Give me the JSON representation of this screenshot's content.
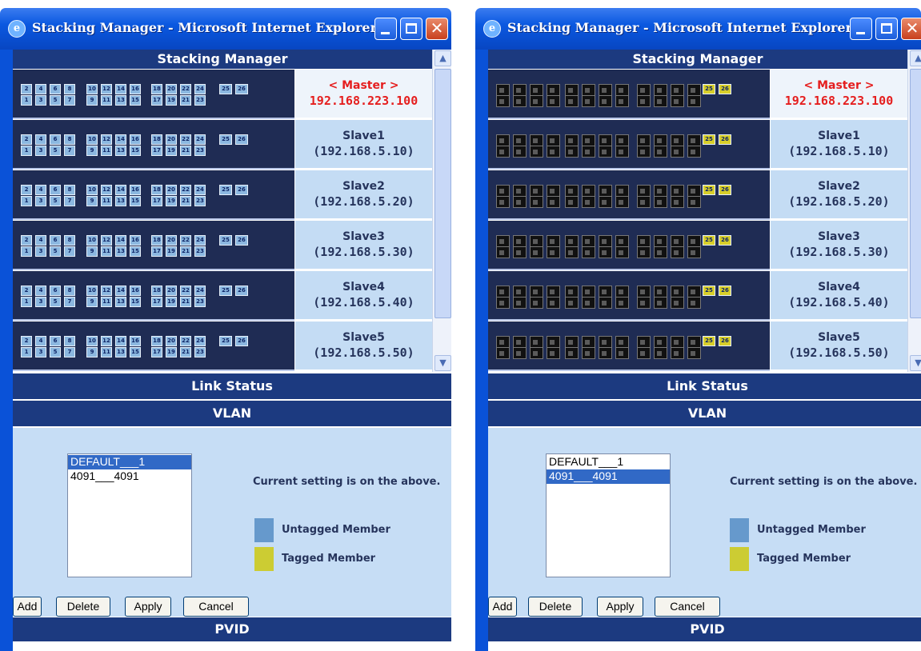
{
  "window": {
    "title": "Stacking Manager - Microsoft Internet Explorer",
    "close_glyph": "✕"
  },
  "page": {
    "header": "Stacking Manager",
    "link_status": "Link Status",
    "vlan_header": "VLAN",
    "pvid_header": "PVID",
    "current_setting": "Current setting is on the above.",
    "legend_untagged": "Untagged Member",
    "legend_tagged": "Tagged Member",
    "colors": {
      "untagged": "#6699cc",
      "tagged": "#cccc33",
      "selection": "#3169c6"
    }
  },
  "units": [
    {
      "name": "< Master >",
      "ip": "192.168.223.100"
    },
    {
      "name": "Slave1",
      "ip": "(192.168.5.10)"
    },
    {
      "name": "Slave2",
      "ip": "(192.168.5.20)"
    },
    {
      "name": "Slave3",
      "ip": "(192.168.5.30)"
    },
    {
      "name": "Slave4",
      "ip": "(192.168.5.40)"
    },
    {
      "name": "Slave5",
      "ip": "(192.168.5.50)"
    }
  ],
  "ports": {
    "top": [
      "2",
      "4",
      "6",
      "8",
      "10",
      "12",
      "14",
      "16",
      "18",
      "20",
      "22",
      "24"
    ],
    "bottom": [
      "1",
      "3",
      "5",
      "7",
      "9",
      "11",
      "13",
      "15",
      "17",
      "19",
      "21",
      "23"
    ],
    "uplink": [
      "25",
      "26"
    ]
  },
  "vlan_list": [
    "DEFAULT___1",
    "4091___4091"
  ],
  "selected_left": "DEFAULT___1",
  "selected_right": "4091___4091",
  "buttons": {
    "add": "Add",
    "delete": "Delete",
    "apply": "Apply",
    "cancel": "Cancel"
  }
}
